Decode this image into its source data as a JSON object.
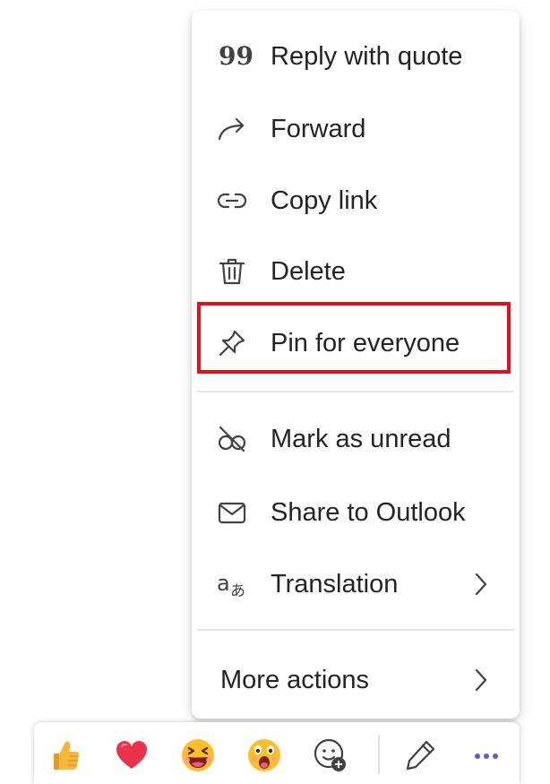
{
  "menu": {
    "items": [
      {
        "label": "Reply with quote",
        "icon": "quote-icon"
      },
      {
        "label": "Forward",
        "icon": "forward-arrow-icon"
      },
      {
        "label": "Copy link",
        "icon": "link-icon"
      },
      {
        "label": "Delete",
        "icon": "trash-icon"
      },
      {
        "label": "Pin for everyone",
        "icon": "pin-icon",
        "highlighted": true
      },
      {
        "label": "Mark as unread",
        "icon": "eye-off-icon"
      },
      {
        "label": "Share to Outlook",
        "icon": "mail-icon"
      },
      {
        "label": "Translation",
        "icon": "translate-icon",
        "submenu": true
      }
    ],
    "more_actions": {
      "label": "More actions",
      "submenu": true
    },
    "highlight_color": "#e0101b"
  },
  "reaction_bar": {
    "reactions": [
      "thumbs-up-icon",
      "heart-icon",
      "laughing-face-icon",
      "surprised-face-icon",
      "add-reaction-icon"
    ],
    "actions": [
      "edit-pencil-icon",
      "more-options-icon"
    ],
    "accent_color": "#5b5fc7"
  }
}
